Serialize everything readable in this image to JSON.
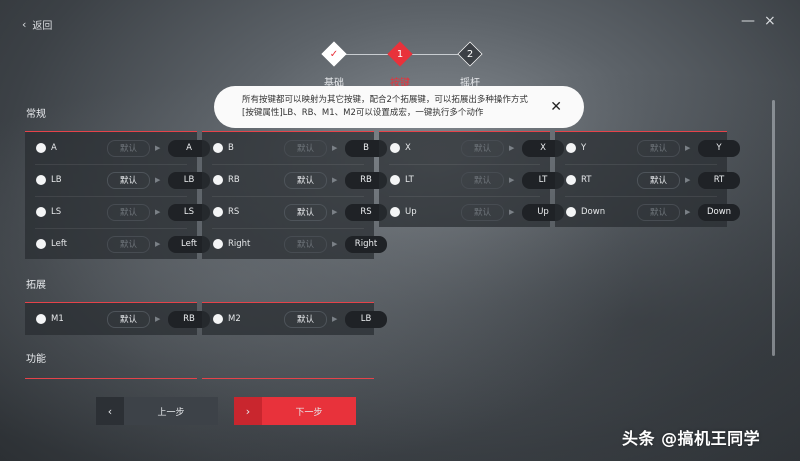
{
  "topbar": {
    "back_label": "返回",
    "back_icon": "‹",
    "minimize_icon": "—",
    "close_icon": "×"
  },
  "steps": [
    {
      "label": "基础",
      "mark": "✓",
      "state": "done"
    },
    {
      "label": "按键",
      "mark": "1",
      "state": "active"
    },
    {
      "label": "摇杆",
      "mark": "2",
      "state": "pending"
    }
  ],
  "tooltip": {
    "line1": "所有按键都可以映射为其它按键，配合2个拓展键，可以拓展出多种操作方式",
    "line2": "[按键属性]LB、RB、M1、M2可以设置成宏，一键执行多个动作",
    "close_icon": "✕"
  },
  "sections": {
    "normal": "常规",
    "extend": "拓展",
    "function": "功能"
  },
  "default_label": "默认",
  "arrow_icon": "▶",
  "normal_panels": [
    {
      "rows": [
        {
          "key": "A",
          "target": "A",
          "custom": false
        },
        {
          "key": "LB",
          "target": "LB",
          "custom": true
        },
        {
          "key": "LS",
          "target": "LS",
          "custom": false
        },
        {
          "key": "Left",
          "target": "Left",
          "custom": false
        }
      ]
    },
    {
      "rows": [
        {
          "key": "B",
          "target": "B",
          "custom": false
        },
        {
          "key": "RB",
          "target": "RB",
          "custom": true
        },
        {
          "key": "RS",
          "target": "RS",
          "custom": true
        },
        {
          "key": "Right",
          "target": "Right",
          "custom": false
        }
      ]
    },
    {
      "rows": [
        {
          "key": "X",
          "target": "X",
          "custom": false
        },
        {
          "key": "LT",
          "target": "LT",
          "custom": false
        },
        {
          "key": "Up",
          "target": "Up",
          "custom": false
        }
      ]
    },
    {
      "rows": [
        {
          "key": "Y",
          "target": "Y",
          "custom": false
        },
        {
          "key": "RT",
          "target": "RT",
          "custom": true
        },
        {
          "key": "Down",
          "target": "Down",
          "custom": false
        }
      ]
    }
  ],
  "extend_panels": [
    {
      "rows": [
        {
          "key": "M1",
          "target": "RB",
          "custom": true
        }
      ]
    },
    {
      "rows": [
        {
          "key": "M2",
          "target": "LB",
          "custom": true
        }
      ]
    }
  ],
  "buttons": {
    "prev_label": "上一步",
    "prev_icon": "‹",
    "next_label": "下一步",
    "next_icon": "›"
  },
  "watermark": "头条 @搞机王同学",
  "colors": {
    "accent": "#e8323b",
    "panel": "#282c31",
    "pill_dark": "#1f2226"
  }
}
